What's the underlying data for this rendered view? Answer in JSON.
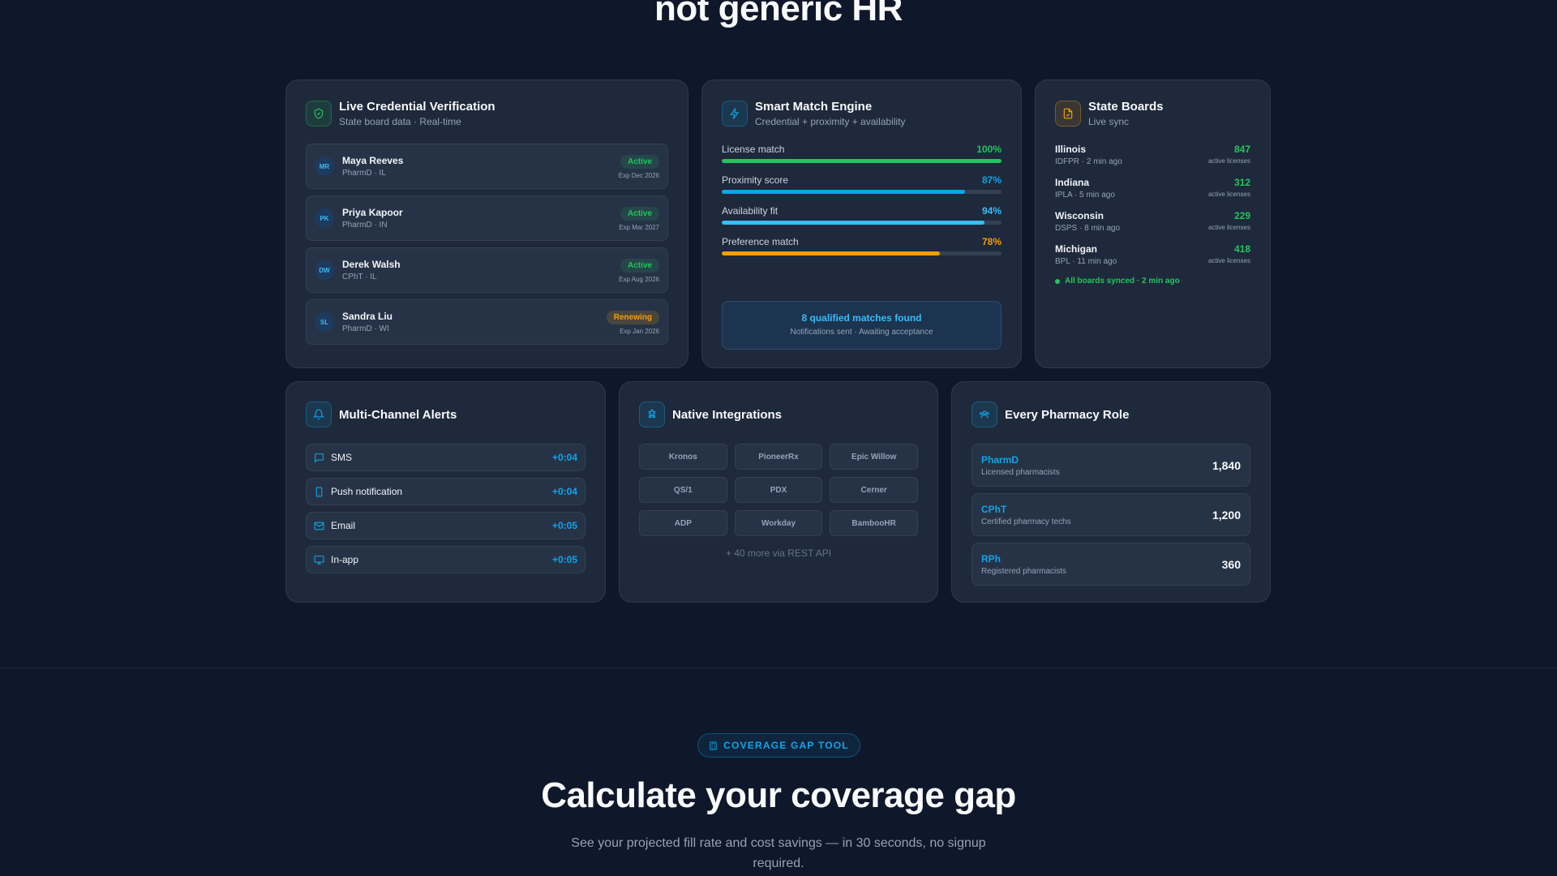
{
  "hero": {
    "title": "not generic HR"
  },
  "credential": {
    "title": "Live Credential Verification",
    "subtitle": "State board data · Real-time",
    "rows": [
      {
        "initials": "MR",
        "name": "Maya Reeves",
        "meta": "PharmD · IL",
        "status": "Active",
        "expiry": "Exp Dec 2026"
      },
      {
        "initials": "PK",
        "name": "Priya Kapoor",
        "meta": "PharmD · IN",
        "status": "Active",
        "expiry": "Exp Mar 2027"
      },
      {
        "initials": "DW",
        "name": "Derek Walsh",
        "meta": "CPhT · IL",
        "status": "Active",
        "expiry": "Exp Aug 2026"
      },
      {
        "initials": "SL",
        "name": "Sandra Liu",
        "meta": "PharmD · WI",
        "status": "Renewing",
        "expiry": "Exp Jan 2026"
      }
    ]
  },
  "match": {
    "title": "Smart Match Engine",
    "subtitle": "Credential + proximity + availability",
    "metrics": [
      {
        "label": "License match",
        "value": "100%",
        "fraction": 1.0,
        "color": "#22c55e"
      },
      {
        "label": "Proximity score",
        "value": "87%",
        "fraction": 0.87,
        "color": "#0ea5e9"
      },
      {
        "label": "Availability fit",
        "value": "94%",
        "fraction": 0.94,
        "color": "#38bdf8"
      },
      {
        "label": "Preference match",
        "value": "78%",
        "fraction": 0.78,
        "color": "#f59e0b"
      }
    ],
    "result_title": "8 qualified matches found",
    "result_sub": "Notifications sent · Awaiting acceptance"
  },
  "boards": {
    "title": "State Boards",
    "subtitle": "Live sync",
    "rows": [
      {
        "state": "Illinois",
        "meta": "IDFPR · 2 min ago",
        "count": "847",
        "label": "active licenses"
      },
      {
        "state": "Indiana",
        "meta": "IPLA · 5 min ago",
        "count": "312",
        "label": "active licenses"
      },
      {
        "state": "Wisconsin",
        "meta": "DSPS · 8 min ago",
        "count": "229",
        "label": "active licenses"
      },
      {
        "state": "Michigan",
        "meta": "BPL · 11 min ago",
        "count": "418",
        "label": "active licenses"
      }
    ],
    "sync_status": "All boards synced · 2 min ago"
  },
  "alerts": {
    "title": "Multi-Channel Alerts",
    "rows": [
      {
        "icon": "chat-icon",
        "label": "SMS",
        "time": "+0:04"
      },
      {
        "icon": "phone-icon",
        "label": "Push notification",
        "time": "+0:04"
      },
      {
        "icon": "mail-icon",
        "label": "Email",
        "time": "+0:05"
      },
      {
        "icon": "monitor-icon",
        "label": "In-app",
        "time": "+0:05"
      }
    ]
  },
  "integrations": {
    "title": "Native Integrations",
    "items": [
      "Kronos",
      "PioneerRx",
      "Epic Willow",
      "QS/1",
      "PDX",
      "Cerner",
      "ADP",
      "Workday",
      "BambooHR"
    ],
    "more": "+ 40 more via REST API"
  },
  "roles": {
    "title": "Every Pharmacy Role",
    "rows": [
      {
        "name": "PharmD",
        "desc": "Licensed pharmacists",
        "count": "1,840"
      },
      {
        "name": "CPhT",
        "desc": "Certified pharmacy techs",
        "count": "1,200"
      },
      {
        "name": "RPh",
        "desc": "Registered pharmacists",
        "count": "360"
      }
    ]
  },
  "coverage": {
    "badge": "COVERAGE GAP TOOL",
    "title": "Calculate your coverage gap",
    "description": "See your projected fill rate and cost savings — in 30 seconds, no signup required."
  }
}
